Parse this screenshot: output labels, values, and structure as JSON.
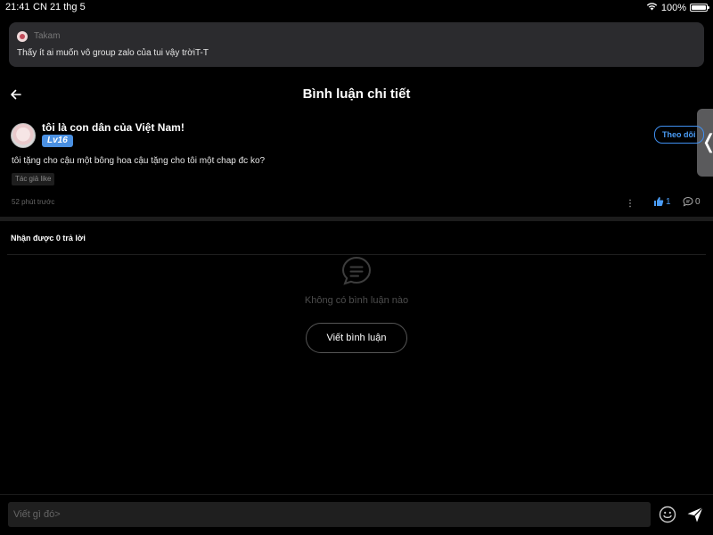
{
  "status_bar": {
    "time": "21:41",
    "date": "CN 21 thg 5",
    "battery": "100%",
    "icons": [
      "wifi-icon",
      "battery-icon"
    ]
  },
  "notification": {
    "sender": "Takam",
    "message": "Thấy ít ai muốn vô group zalo của tui vậy trờiT-T"
  },
  "header": {
    "title": "Bình luận chi tiết",
    "back_icon": "arrow-left-icon"
  },
  "comment": {
    "username": "tôi là con dân của Việt Nam!",
    "level": "Lv16",
    "follow_label": "Theo dõi",
    "text": "tôi tặng cho cậu một bông hoa cậu tặng cho tôi một chap đc ko?",
    "author_like": "Tác giả like",
    "timestamp": "52 phút trước",
    "likes": "1",
    "replies": "0"
  },
  "side_handle": {
    "glyph": "❬"
  },
  "replies_section": {
    "header": "Nhận được 0 trả lời",
    "empty_text": "Không có bình luận nào",
    "write_button": "Viết bình luận"
  },
  "input_bar": {
    "placeholder": "Viết gì đó>"
  },
  "colors": {
    "background": "#000000",
    "accent": "#4a90e2",
    "banner": "#2b2b2e"
  }
}
